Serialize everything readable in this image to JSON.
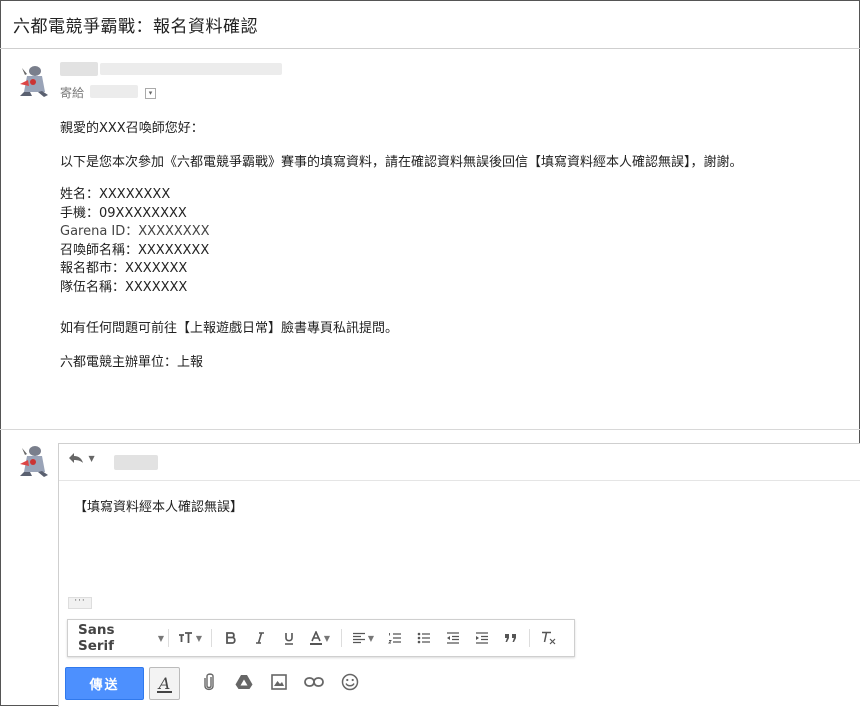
{
  "email": {
    "subject": "六都電競爭霸戰：報名資料確認",
    "to_label": "寄給",
    "greeting": "親愛的XXX召喚師您好：",
    "intro": "以下是您本次參加《六都電競爭霸戰》賽事的填寫資料，請在確認資料無誤後回信【填寫資料經本人確認無誤】，謝謝。",
    "fields": [
      "姓名：XXXXXXXX",
      "手機：09XXXXXXXX",
      "Garena ID：XXXXXXXX",
      "召喚師名稱：XXXXXXXX",
      "報名都市：XXXXXXX",
      "隊伍名稱：XXXXXXX"
    ],
    "contact": "如有任何問題可前往【上報遊戲日常】臉書專頁私訊提問。",
    "signature": "六都電競主辦單位：上報"
  },
  "compose": {
    "body": "【填寫資料經本人確認無誤】",
    "more_dots": "···",
    "font_name": "Sans Serif",
    "send_label": "傳送"
  },
  "icons": {
    "reply": "reply-icon",
    "avatar": "avatar-icon",
    "text_size": "text-size-icon",
    "bold": "bold-icon",
    "italic": "italic-icon",
    "underline": "underline-icon",
    "text_color": "text-color-icon",
    "align": "align-icon",
    "numbered_list": "numbered-list-icon",
    "bulleted_list": "bulleted-list-icon",
    "indent_less": "indent-less-icon",
    "indent_more": "indent-more-icon",
    "quote": "quote-icon",
    "clear_format": "clear-format-icon",
    "attach": "paperclip-icon",
    "drive": "drive-icon",
    "photo": "photo-icon",
    "link": "link-icon",
    "emoji": "emoji-icon"
  },
  "colors": {
    "send_button": "#4d90fe",
    "border": "#cfcfcf"
  }
}
